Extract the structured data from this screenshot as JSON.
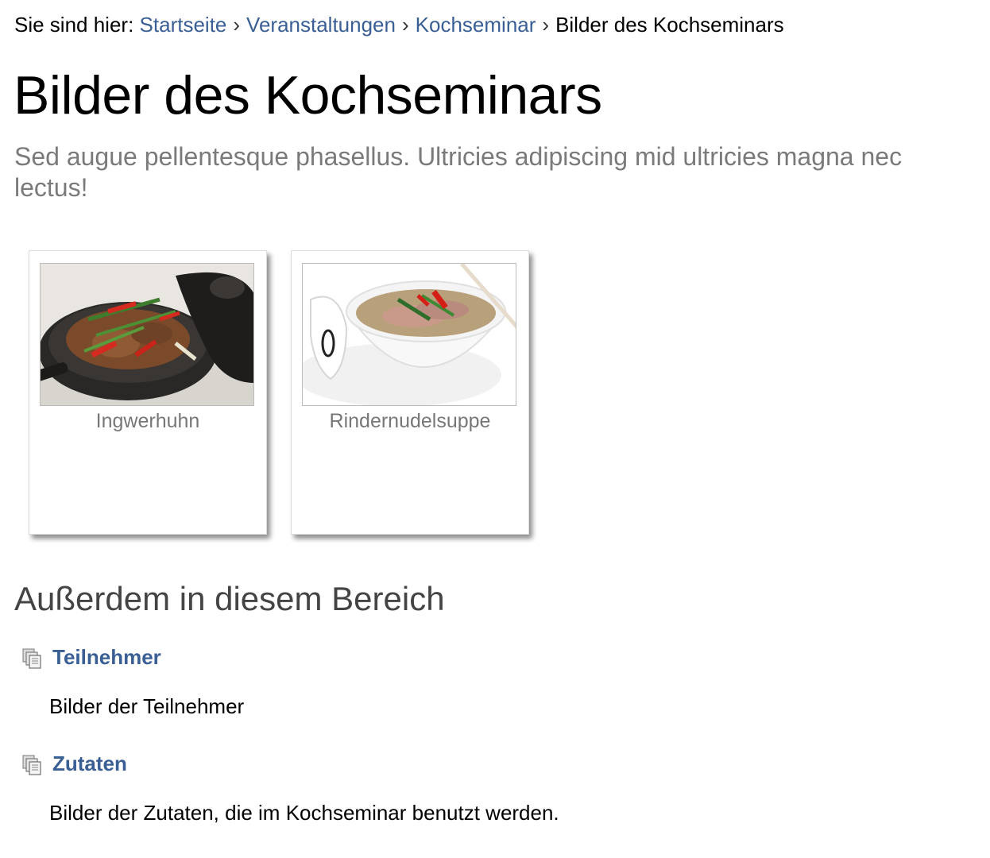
{
  "breadcrumb": {
    "prefix": "Sie sind hier:",
    "links": [
      "Startseite",
      "Veranstaltungen",
      "Kochseminar"
    ],
    "separator": "›",
    "current": "Bilder des Kochseminars"
  },
  "page": {
    "title": "Bilder des Kochseminars",
    "description": "Sed augue pellentesque phasellus. Ultricies adipiscing mid ultricies magna nec lectus!"
  },
  "gallery": {
    "items": [
      {
        "caption": "Ingwerhuhn",
        "image": "ginger-chicken-wok-photo"
      },
      {
        "caption": "Rindernudelsuppe",
        "image": "beef-noodle-soup-photo"
      }
    ]
  },
  "related": {
    "heading": "Außerdem in diesem Bereich",
    "items": [
      {
        "title": "Teilnehmer",
        "description": "Bilder der Teilnehmer",
        "icon": "folder-icon"
      },
      {
        "title": "Zutaten",
        "description": "Bilder der Zutaten, die im Kochseminar benutzt werden.",
        "icon": "folder-icon"
      }
    ]
  },
  "colors": {
    "link": "#3a5f95",
    "muted_text": "#7a7a7a",
    "heading_gray": "#444444"
  }
}
